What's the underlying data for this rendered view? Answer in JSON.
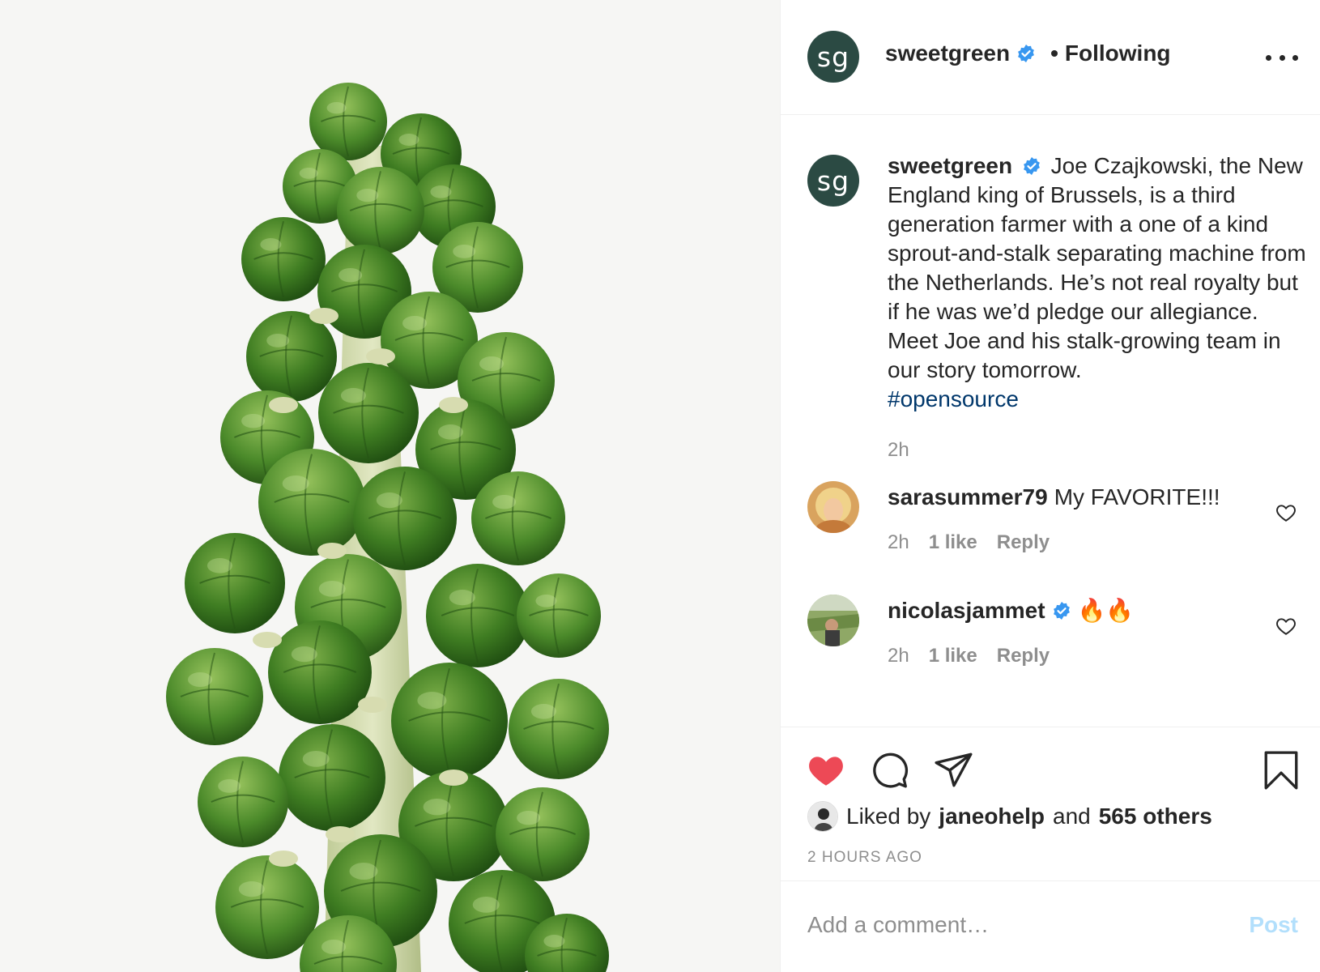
{
  "post": {
    "image_description_icon": "brussels-sprout-stalk-photo",
    "author": "sweetgreen",
    "author_initials": "sg",
    "verified": true,
    "separator": "•",
    "follow_label": "Following"
  },
  "caption": {
    "username": "sweetgreen",
    "text": "Joe Czajkowski, the New England king of Brussels, is a third generation farmer with a one of a kind sprout-and-stalk separating machine from the Netherlands. He’s not real royalty but if he was we’d pledge our allegiance. Meet Joe and his stalk-growing team in our story tomorrow.",
    "hashtag": "#opensource",
    "time": "2h"
  },
  "comments": [
    {
      "username": "sarasummer79",
      "verified": false,
      "text": "My FAVORITE!!!",
      "time": "2h",
      "likes": "1 like",
      "reply": "Reply"
    },
    {
      "username": "nicolasjammet",
      "verified": true,
      "text": "🔥🔥",
      "time": "2h",
      "likes": "1 like",
      "reply": "Reply"
    }
  ],
  "actions": {
    "liked": true,
    "liked_by_prefix": "Liked by",
    "liked_by_user": "janeohelp",
    "liked_by_and": "and",
    "liked_by_others": "565 others",
    "post_age": "2 HOURS AGO"
  },
  "add_comment": {
    "placeholder": "Add a comment…",
    "post_label": "Post"
  },
  "colors": {
    "brand_avatar": "#2b4a43",
    "verified_blue": "#3897f0",
    "like_red": "#ed4956",
    "hashtag": "#00376b",
    "post_disabled": "#b2dffc"
  }
}
